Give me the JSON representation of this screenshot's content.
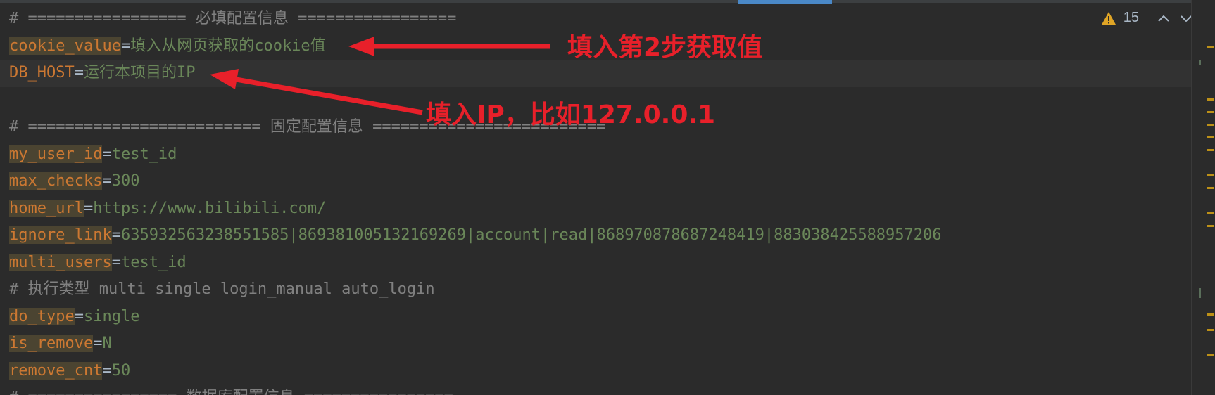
{
  "editor": {
    "lines": [
      {
        "type": "comment",
        "text": "# ================= 必填配置信息 ================="
      },
      {
        "type": "kv",
        "key": "cookie_value",
        "value": "填入从网页获取的cookie值",
        "current": false
      },
      {
        "type": "kv",
        "key": "DB_HOST",
        "value": "运行本项目的IP",
        "current": true,
        "plain": true
      },
      {
        "type": "blank"
      },
      {
        "type": "comment",
        "text": "# ========================= 固定配置信息 ========================="
      },
      {
        "type": "kv",
        "key": "my_user_id",
        "value": "test_id"
      },
      {
        "type": "kv",
        "key": "max_checks",
        "value": "300"
      },
      {
        "type": "kv",
        "key": "home_url",
        "value": "https://www.bilibili.com/"
      },
      {
        "type": "kv",
        "key": "ignore_link",
        "value": "635932563238551585|869381005132169269|account|read|868970878687248419|883038425588957206"
      },
      {
        "type": "kv",
        "key": "multi_users",
        "value": "test_id"
      },
      {
        "type": "comment",
        "text": "# 执行类型 multi single login_manual auto_login"
      },
      {
        "type": "kv",
        "key": "do_type",
        "value": "single"
      },
      {
        "type": "kv",
        "key": "is_remove",
        "value": "N"
      },
      {
        "type": "kv",
        "key": "remove_cnt",
        "value": "50"
      },
      {
        "type": "comment",
        "text": "# ================ 数据库配置信息 ================"
      }
    ]
  },
  "inspector": {
    "warning_count": "15",
    "warning_icon": "warning-triangle-icon",
    "up_icon": "chevron-up-icon",
    "down_icon": "chevron-down-icon"
  },
  "annotations": {
    "note1": "填入第2步获取值",
    "note2": "填入IP，比如127.0.0.1",
    "color": "#e8202a"
  },
  "colors": {
    "background": "#2b2b2b",
    "key": "#cc7832",
    "value": "#6a8759",
    "comment": "#808080",
    "tab_accent": "#4a88c7",
    "warning": "#be9117"
  }
}
